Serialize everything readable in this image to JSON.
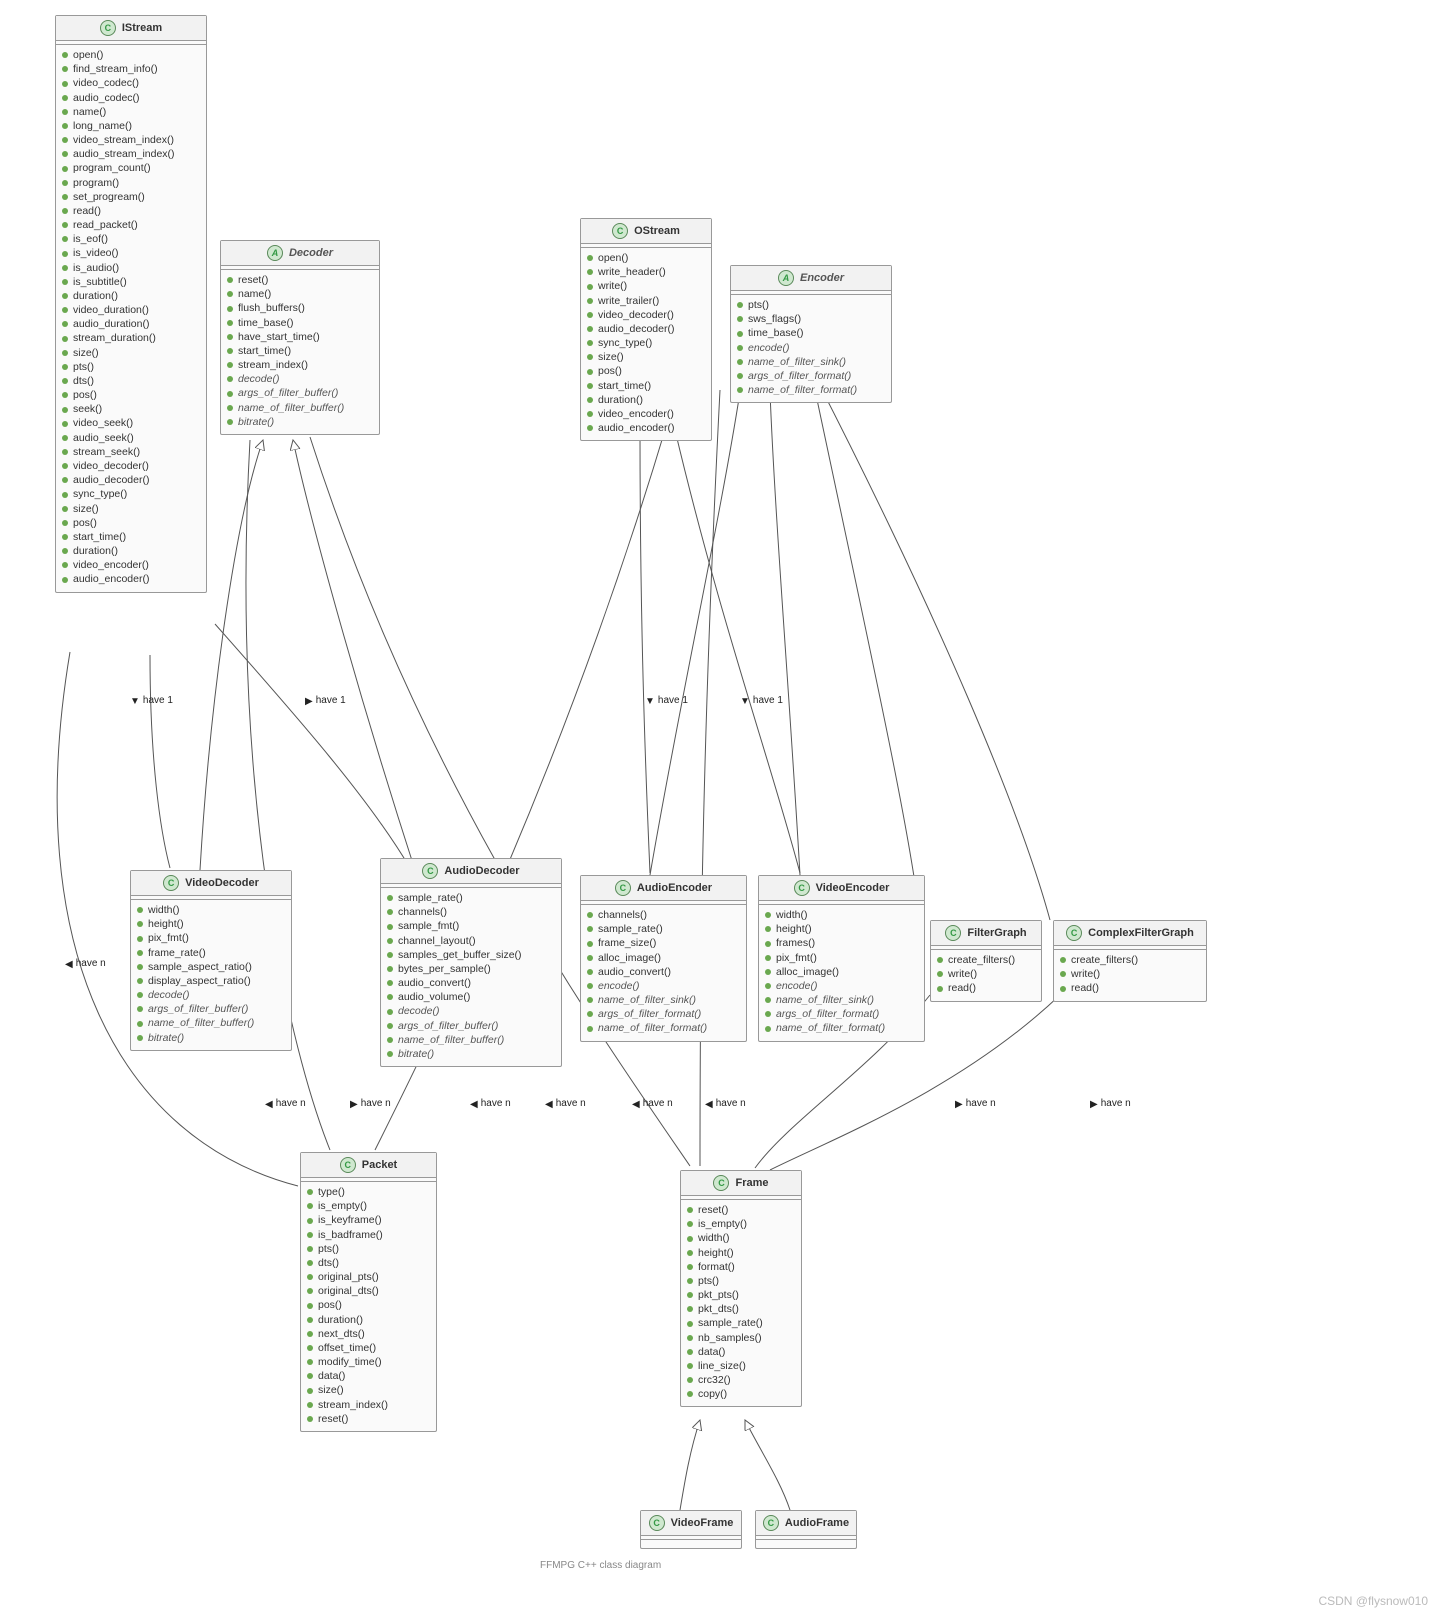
{
  "caption": "FFMPG C++ class diagram",
  "watermark": "CSDN @flysnow010",
  "labels": {
    "have1_a": "have 1",
    "have1_b": "have 1",
    "have1_c": "have 1",
    "have1_d": "have 1",
    "haven_a": "have n",
    "haven_b": "have n",
    "haven_c": "have n",
    "haven_d": "have n",
    "haven_e": "have n",
    "haven_f": "have n",
    "haven_g": "have n",
    "haven_h": "have n",
    "haven_i": "have n"
  },
  "classes": {
    "IStream": {
      "title": "IStream",
      "kind": "C",
      "members": [
        "open()",
        "find_stream_info()",
        "video_codec()",
        "audio_codec()",
        "name()",
        "long_name()",
        "video_stream_index()",
        "audio_stream_index()",
        "program_count()",
        "program()",
        "set_progream()",
        "read()",
        "read_packet()",
        "is_eof()",
        "is_video()",
        "is_audio()",
        "is_subtitle()",
        "duration()",
        "video_duration()",
        "audio_duration()",
        "stream_duration()",
        "size()",
        "pts()",
        "dts()",
        "pos()",
        "seek()",
        "video_seek()",
        "audio_seek()",
        "stream_seek()",
        "video_decoder()",
        "audio_decoder()",
        "sync_type()",
        "size()",
        "pos()",
        "start_time()",
        "duration()",
        "video_encoder()",
        "audio_encoder()"
      ],
      "italic": []
    },
    "Decoder": {
      "title": "Decoder",
      "kind": "A",
      "members": [
        "reset()",
        "name()",
        "flush_buffers()",
        "time_base()",
        "have_start_time()",
        "start_time()",
        "stream_index()",
        "decode()",
        "args_of_filter_buffer()",
        "name_of_filter_buffer()",
        "bitrate()"
      ],
      "italic": [
        "decode()",
        "args_of_filter_buffer()",
        "name_of_filter_buffer()",
        "bitrate()"
      ]
    },
    "OStream": {
      "title": "OStream",
      "kind": "C",
      "members": [
        "open()",
        "write_header()",
        "write()",
        "write_trailer()",
        "video_decoder()",
        "audio_decoder()",
        "sync_type()",
        "size()",
        "pos()",
        "start_time()",
        "duration()",
        "video_encoder()",
        "audio_encoder()"
      ],
      "italic": []
    },
    "Encoder": {
      "title": "Encoder",
      "kind": "A",
      "members": [
        "pts()",
        "sws_flags()",
        "time_base()",
        "encode()",
        "name_of_filter_sink()",
        "args_of_filter_format()",
        "name_of_filter_format()"
      ],
      "italic": [
        "encode()",
        "name_of_filter_sink()",
        "args_of_filter_format()",
        "name_of_filter_format()"
      ]
    },
    "VideoDecoder": {
      "title": "VideoDecoder",
      "kind": "C",
      "members": [
        "width()",
        "height()",
        "pix_fmt()",
        "frame_rate()",
        "sample_aspect_ratio()",
        "display_aspect_ratio()",
        "decode()",
        "args_of_filter_buffer()",
        "name_of_filter_buffer()",
        "bitrate()"
      ],
      "italic": [
        "decode()",
        "args_of_filter_buffer()",
        "name_of_filter_buffer()",
        "bitrate()"
      ]
    },
    "AudioDecoder": {
      "title": "AudioDecoder",
      "kind": "C",
      "members": [
        "sample_rate()",
        "channels()",
        "sample_fmt()",
        "channel_layout()",
        "samples_get_buffer_size()",
        "bytes_per_sample()",
        "audio_convert()",
        "audio_volume()",
        "decode()",
        "args_of_filter_buffer()",
        "name_of_filter_buffer()",
        "bitrate()"
      ],
      "italic": [
        "decode()",
        "args_of_filter_buffer()",
        "name_of_filter_buffer()",
        "bitrate()"
      ]
    },
    "AudioEncoder": {
      "title": "AudioEncoder",
      "kind": "C",
      "members": [
        "channels()",
        "sample_rate()",
        "frame_size()",
        "alloc_image()",
        "audio_convert()",
        "encode()",
        "name_of_filter_sink()",
        "args_of_filter_format()",
        "name_of_filter_format()"
      ],
      "italic": [
        "encode()",
        "name_of_filter_sink()",
        "args_of_filter_format()",
        "name_of_filter_format()"
      ]
    },
    "VideoEncoder": {
      "title": "VideoEncoder",
      "kind": "C",
      "members": [
        "width()",
        "height()",
        "frames()",
        "pix_fmt()",
        "alloc_image()",
        "encode()",
        "name_of_filter_sink()",
        "args_of_filter_format()",
        "name_of_filter_format()"
      ],
      "italic": [
        "encode()",
        "name_of_filter_sink()",
        "args_of_filter_format()",
        "name_of_filter_format()"
      ]
    },
    "FilterGraph": {
      "title": "FilterGraph",
      "kind": "C",
      "members": [
        "create_filters()",
        "write()",
        "read()"
      ],
      "italic": []
    },
    "ComplexFilterGraph": {
      "title": "ComplexFilterGraph",
      "kind": "C",
      "members": [
        "create_filters()",
        "write()",
        "read()"
      ],
      "italic": []
    },
    "Packet": {
      "title": "Packet",
      "kind": "C",
      "members": [
        "type()",
        "is_empty()",
        "is_keyframe()",
        "is_badframe()",
        "pts()",
        "dts()",
        "original_pts()",
        "original_dts()",
        "pos()",
        "duration()",
        "next_dts()",
        "offset_time()",
        "modify_time()",
        "data()",
        "size()",
        "stream_index()",
        "reset()"
      ],
      "italic": []
    },
    "Frame": {
      "title": "Frame",
      "kind": "C",
      "members": [
        "reset()",
        "is_empty()",
        "width()",
        "height()",
        "format()",
        "pts()",
        "pkt_pts()",
        "pkt_dts()",
        "sample_rate()",
        "nb_samples()",
        "data()",
        "line_size()",
        "crc32()",
        "copy()"
      ],
      "italic": []
    },
    "VideoFrame": {
      "title": "VideoFrame",
      "kind": "C",
      "members": [],
      "italic": []
    },
    "AudioFrame": {
      "title": "AudioFrame",
      "kind": "C",
      "members": [],
      "italic": []
    }
  }
}
